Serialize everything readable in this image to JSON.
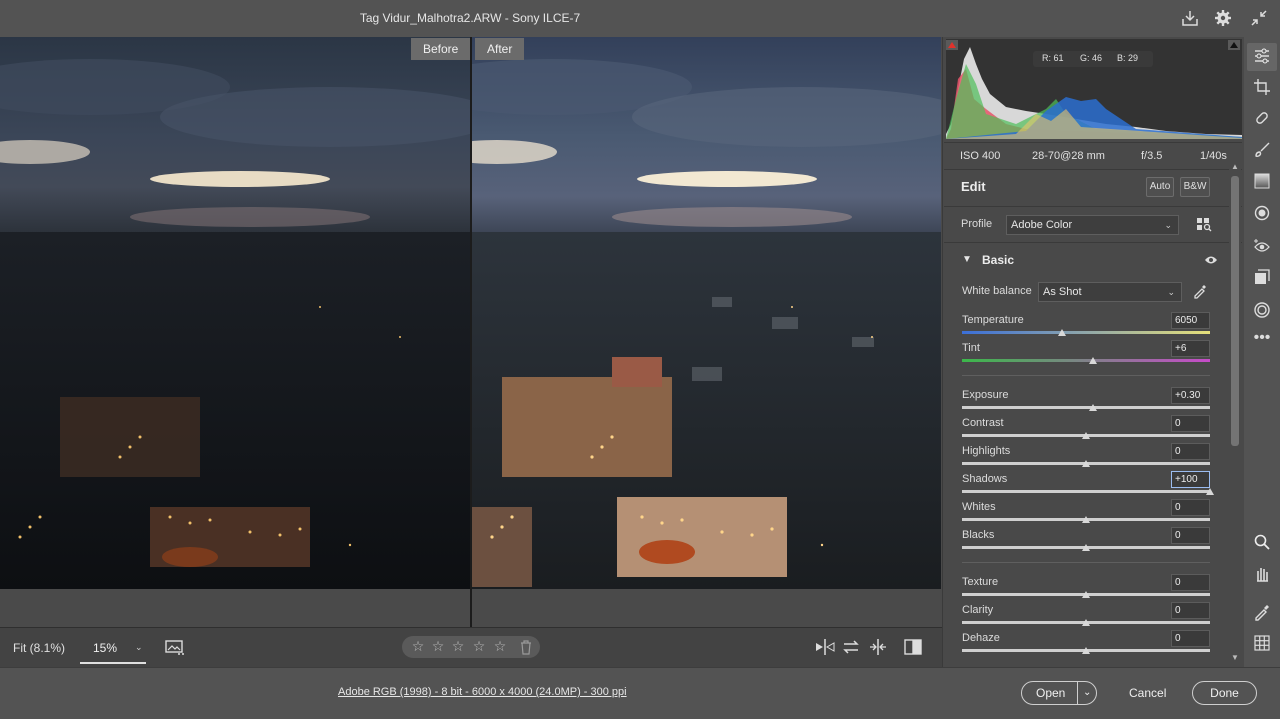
{
  "window": {
    "title": "Tag Vidur_Malhotra2.ARW  -  Sony ILCE-7"
  },
  "titlebar_icons": [
    "save-icon",
    "gear-icon",
    "collapse-icon"
  ],
  "view": {
    "before_label": "Before",
    "after_label": "After"
  },
  "histogram": {
    "r": "R: 61",
    "g": "G: 46",
    "b": "B: 29"
  },
  "camera": {
    "iso": "ISO 400",
    "lens": "28-70@28 mm",
    "aperture": "f/3.5",
    "shutter": "1/40s"
  },
  "edit": {
    "title": "Edit",
    "auto_label": "Auto",
    "bw_label": "B&W",
    "profile_label": "Profile",
    "profile_value": "Adobe Color",
    "section_basic": "Basic",
    "white_balance_label": "White balance",
    "white_balance_value": "As Shot"
  },
  "sliders": {
    "temperature": {
      "label": "Temperature",
      "value": "6050",
      "position": 0.405
    },
    "tint": {
      "label": "Tint",
      "value": "+6",
      "position": 0.53
    },
    "exposure": {
      "label": "Exposure",
      "value": "+0.30",
      "position": 0.53
    },
    "contrast": {
      "label": "Contrast",
      "value": "0",
      "position": 0.5
    },
    "highlights": {
      "label": "Highlights",
      "value": "0",
      "position": 0.5
    },
    "shadows": {
      "label": "Shadows",
      "value": "+100",
      "position": 1.0
    },
    "whites": {
      "label": "Whites",
      "value": "0",
      "position": 0.5
    },
    "blacks": {
      "label": "Blacks",
      "value": "0",
      "position": 0.5
    },
    "texture": {
      "label": "Texture",
      "value": "0",
      "position": 0.5
    },
    "clarity": {
      "label": "Clarity",
      "value": "0",
      "position": 0.5
    },
    "dehaze": {
      "label": "Dehaze",
      "value": "0",
      "position": 0.5
    }
  },
  "bottombar": {
    "fit_label": "Fit (8.1%)",
    "zoom_value": "15%"
  },
  "status": {
    "info_link": "Adobe RGB (1998) - 8 bit - 6000 x 4000 (24.0MP) - 300 ppi",
    "open_label": "Open",
    "cancel_label": "Cancel",
    "done_label": "Done"
  },
  "colors": {
    "accent_red": "#e0322b",
    "panel_bg": "#494949"
  }
}
